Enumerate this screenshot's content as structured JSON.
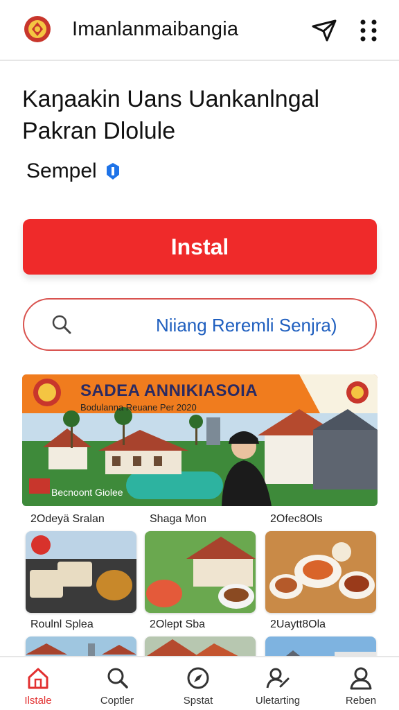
{
  "header": {
    "app_title": "Imanlanmaibangia",
    "logo_icon": "emblem-logo",
    "send_icon": "send-icon",
    "more_icon": "more-vertical-icon"
  },
  "main": {
    "heading": "Kaŋaakin Uans Uankanlngal Pakran Dlolule",
    "subtitle": "Sempel",
    "install_label": "Instal",
    "search_placeholder": "Niiang Reremli Senjra)"
  },
  "banner": {
    "title": "SADEA ANNIKIASOIA",
    "subtitle": "Bodulanna Reuane Per 2020",
    "footer": "Becnoont Giolee",
    "accent_color": "#f07c1e"
  },
  "categories": [
    {
      "label": "2Odeyä Sralan"
    },
    {
      "label": "Shaga Mon"
    },
    {
      "label": "2Ofec8Ols"
    },
    {
      "label": "Roulnl Splea"
    },
    {
      "label": "2Olept Sba"
    },
    {
      "label": "2Uaytt8Ola"
    }
  ],
  "bottom_nav": [
    {
      "label": "Ilstale",
      "icon": "home-icon",
      "active": true
    },
    {
      "label": "Coptler",
      "icon": "search-icon",
      "active": false
    },
    {
      "label": "Spstat",
      "icon": "compass-icon",
      "active": false
    },
    {
      "label": "Uletarting",
      "icon": "user-edit-icon",
      "active": false
    },
    {
      "label": "Reben",
      "icon": "profile-icon",
      "active": false
    }
  ],
  "colors": {
    "primary": "#ef2a2a",
    "link": "#1f5fbf",
    "active_nav": "#e23030"
  }
}
